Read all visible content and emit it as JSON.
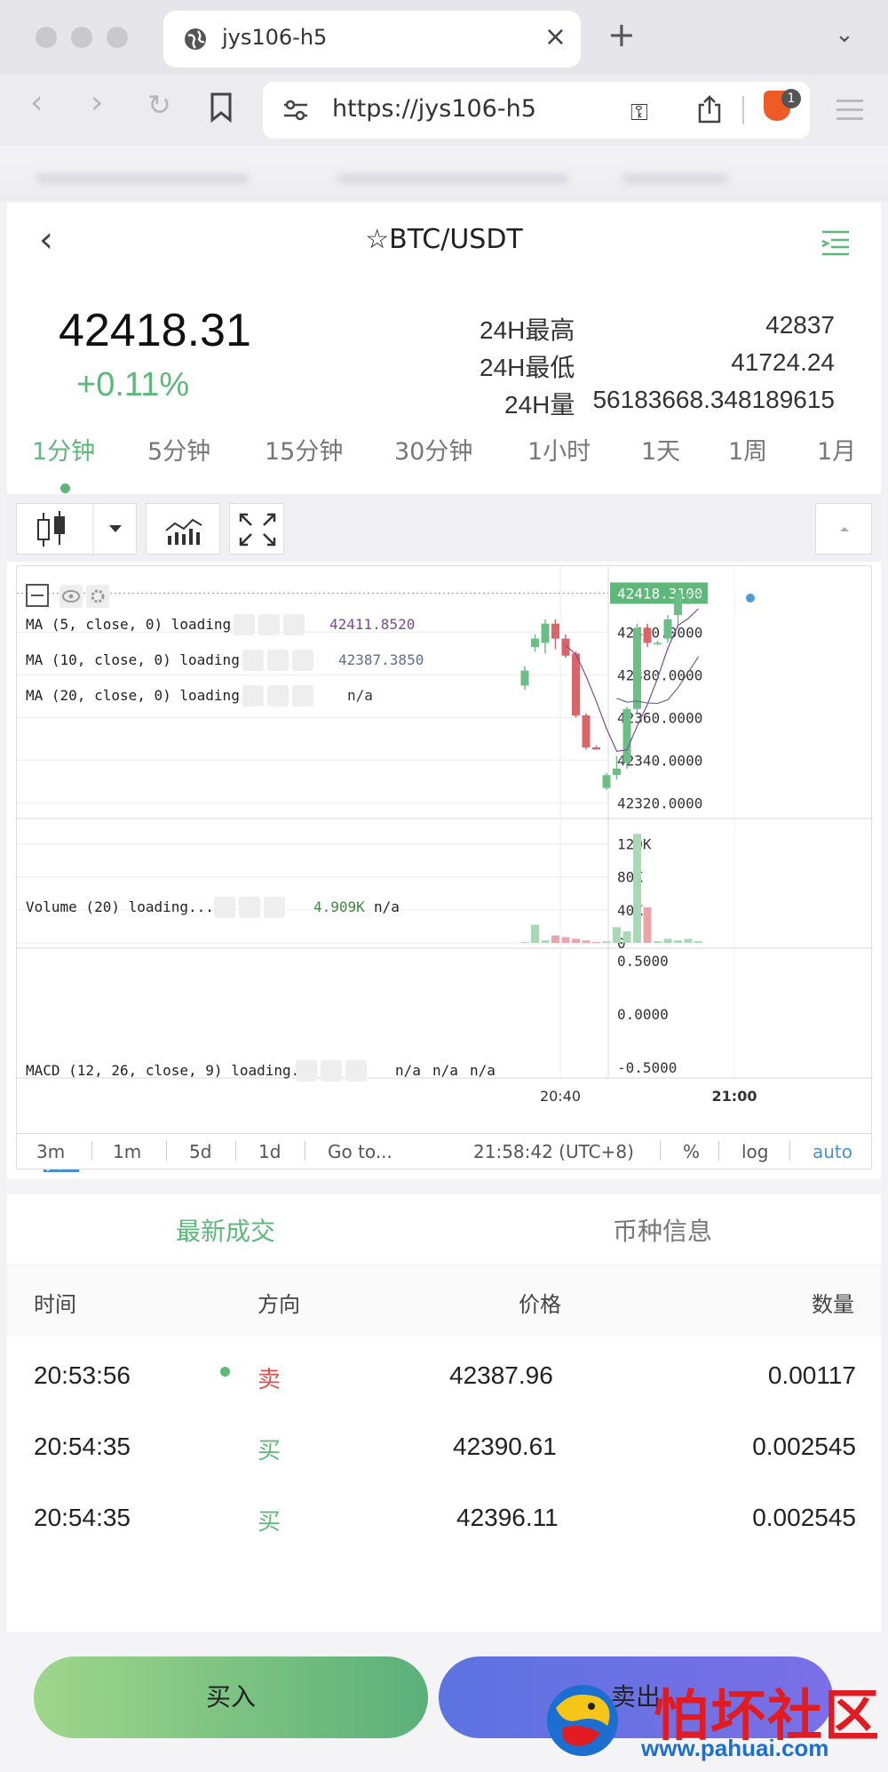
{
  "browser": {
    "tab_title": "jys106-h5",
    "tab_close": "×",
    "new_tab": "+",
    "tab_menu": "⌄",
    "url": "https://jys106-h5",
    "brave_badge": "1"
  },
  "header": {
    "back": "‹",
    "star": "☆",
    "pair": "BTC/USDT"
  },
  "ticker": {
    "last_price": "42418.31",
    "change_pct": "+0.11%",
    "stats": [
      {
        "label": "24H最高",
        "value": "42837"
      },
      {
        "label": "24H最低",
        "value": "41724.24"
      },
      {
        "label": "24H量",
        "value": "56183668.348189615"
      }
    ]
  },
  "periods": [
    "1分钟",
    "5分钟",
    "15分钟",
    "30分钟",
    "1小时",
    "1天",
    "1周",
    "1月"
  ],
  "active_period": "1分钟",
  "chart_legends": {
    "ma5": {
      "label": "MA (5, close, 0) loading...",
      "value": "42411.8520"
    },
    "ma10": {
      "label": "MA (10, close, 0) loading...",
      "value": "42387.3850"
    },
    "ma20": {
      "label": "MA (20, close, 0) loading...",
      "value": "n/a"
    },
    "volume": {
      "label": "Volume (20) loading...",
      "value1": "4.909K",
      "value2": "n/a"
    },
    "macd": {
      "label": "MACD (12, 26, close, 9) loading...",
      "v1": "n/a",
      "v2": "n/a",
      "v3": "n/a"
    }
  },
  "chart_data": {
    "type": "candlestick",
    "last_price_label": "42418.3100",
    "price_axis": [
      "42400.0000",
      "42380.0000",
      "42360.0000",
      "42340.0000",
      "42320.0000"
    ],
    "volume_axis": [
      "120K",
      "80K",
      "40K",
      "0"
    ],
    "macd_axis": [
      "0.5000",
      "0.0000",
      "-0.5000"
    ],
    "time_ticks": [
      "20:40",
      "21:00"
    ],
    "candles": [
      {
        "o": 42375,
        "c": 42382,
        "h": 42384,
        "l": 42373
      },
      {
        "o": 42393,
        "c": 42397,
        "h": 42399,
        "l": 42391
      },
      {
        "o": 42395,
        "c": 42404,
        "h": 42406,
        "l": 42390
      },
      {
        "o": 42404,
        "c": 42397,
        "h": 42406,
        "l": 42392
      },
      {
        "o": 42397,
        "c": 42389,
        "h": 42399,
        "l": 42388
      },
      {
        "o": 42390,
        "c": 42361,
        "h": 42391,
        "l": 42360
      },
      {
        "o": 42361,
        "c": 42346,
        "h": 42362,
        "l": 42345
      },
      {
        "o": 42346,
        "c": 42345,
        "h": 42347,
        "l": 42345
      },
      {
        "o": 42327,
        "c": 42333,
        "h": 42334,
        "l": 42326
      },
      {
        "o": 42333,
        "c": 42336,
        "h": 42342,
        "l": 42331
      },
      {
        "o": 42339,
        "c": 42364,
        "h": 42365,
        "l": 42336
      },
      {
        "o": 42364,
        "c": 42402,
        "h": 42404,
        "l": 42362
      },
      {
        "o": 42402,
        "c": 42395,
        "h": 42404,
        "l": 42393
      },
      {
        "o": 42395,
        "c": 42395,
        "h": 42396,
        "l": 42394
      },
      {
        "o": 42397,
        "c": 42406,
        "h": 42408,
        "l": 42395
      },
      {
        "o": 42408,
        "c": 42418,
        "h": 42419,
        "l": 42402
      },
      {
        "o": 42418,
        "c": 42418,
        "h": 42418,
        "l": 42413
      },
      {
        "o": 42418,
        "c": 42418,
        "h": 42418,
        "l": 42418
      }
    ],
    "volumes": [
      1000,
      22000,
      3000,
      9000,
      7000,
      5000,
      3000,
      1000,
      2000,
      19000,
      14000,
      132000,
      43000,
      2000,
      5000,
      3000,
      4909,
      2000
    ]
  },
  "timebar": {
    "items": [
      "3m",
      "1m",
      "5d",
      "1d",
      "Go to...",
      "21:58:42 (UTC+8)",
      "%",
      "log",
      "auto"
    ]
  },
  "trade_tabs": [
    "最新成交",
    "币种信息"
  ],
  "trade_headers": [
    "时间",
    "方向",
    "价格",
    "数量"
  ],
  "trades": [
    {
      "time": "20:53:56",
      "side": "卖",
      "price": "42387.96",
      "qty": "0.00117"
    },
    {
      "time": "20:54:35",
      "side": "买",
      "price": "42390.61",
      "qty": "0.002545"
    },
    {
      "time": "20:54:35",
      "side": "买",
      "price": "42396.11",
      "qty": "0.002545"
    }
  ],
  "actions": {
    "buy": "买入",
    "sell": "卖出"
  },
  "watermark": {
    "title": "怕坏社区",
    "url": "www.pahuai.com"
  },
  "colors": {
    "up": "#5db87a",
    "down": "#d9534f",
    "accent": "#5db87a"
  }
}
